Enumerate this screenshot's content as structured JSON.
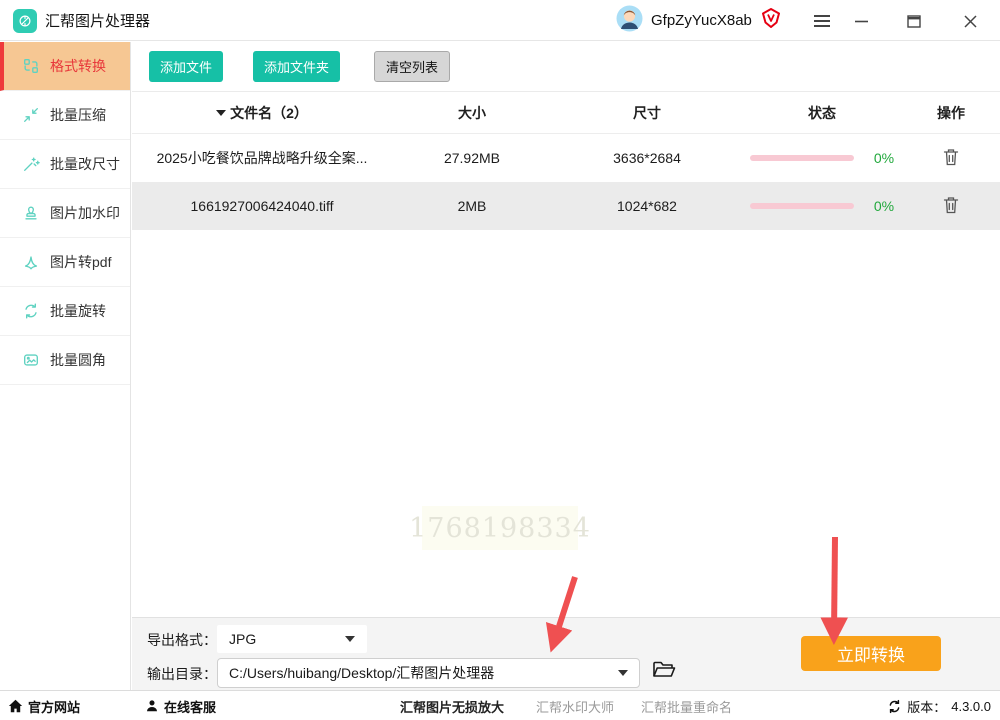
{
  "titlebar": {
    "app_title": "汇帮图片处理器",
    "username": "GfpZyYucX8ab"
  },
  "sidebar": {
    "items": [
      {
        "label": "格式转换",
        "icon": "format-convert-icon",
        "active": true
      },
      {
        "label": "批量压缩",
        "icon": "batch-compress-icon",
        "active": false
      },
      {
        "label": "批量改尺寸",
        "icon": "batch-resize-icon",
        "active": false
      },
      {
        "label": "图片加水印",
        "icon": "watermark-stamp-icon",
        "active": false
      },
      {
        "label": "图片转pdf",
        "icon": "image-to-pdf-icon",
        "active": false
      },
      {
        "label": "批量旋转",
        "icon": "batch-rotate-icon",
        "active": false
      },
      {
        "label": "批量圆角",
        "icon": "rounded-corner-icon",
        "active": false
      }
    ]
  },
  "toolbar": {
    "add_file": "添加文件",
    "add_folder": "添加文件夹",
    "clear_list": "清空列表"
  },
  "table": {
    "headers": {
      "filename": "文件名（2）",
      "size": "大小",
      "dimensions": "尺寸",
      "status": "状态",
      "action": "操作"
    },
    "rows": [
      {
        "filename": "2025小吃餐饮品牌战略升级全案...",
        "size": "27.92MB",
        "dimensions": "3636*2684",
        "progress_percent": 0,
        "progress_label": "0%"
      },
      {
        "filename": "1661927006424040.tiff",
        "size": "2MB",
        "dimensions": "1024*682",
        "progress_percent": 0,
        "progress_label": "0%"
      }
    ]
  },
  "watermark_text": "1768198334",
  "output_panel": {
    "format_label": "导出格式：",
    "format_value": "JPG",
    "dir_label": "输出目录：",
    "dir_value": "C:/Users/huibang/Desktop/汇帮图片处理器",
    "convert_label": "立即转换"
  },
  "statusbar": {
    "official_site": "官方网站",
    "customer_service": "在线客服",
    "links": [
      "汇帮图片无损放大",
      "汇帮水印大师",
      "汇帮批量重命名"
    ],
    "version_label": "版本：",
    "version_value": "4.3.0.0"
  },
  "colors": {
    "brand_teal": "#16c0a6",
    "active_item_bg": "#f6c793",
    "active_item_red": "#ee3a3b",
    "convert_orange": "#f9a21b",
    "progress_pink": "#f8c9d3",
    "percent_green": "#21a83c",
    "annotation_arrow_red": "#ef5051",
    "vip_red": "#e60012"
  }
}
